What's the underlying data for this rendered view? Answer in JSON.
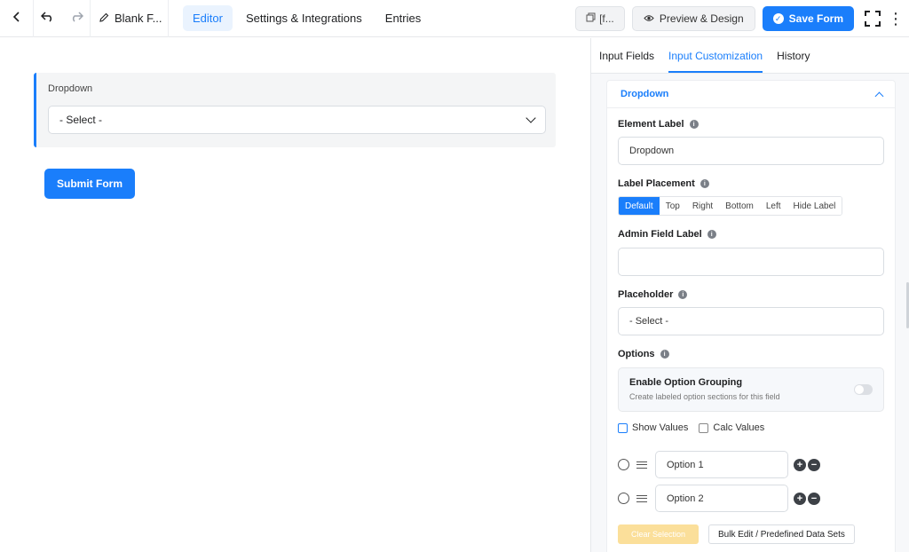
{
  "topbar": {
    "form_title": "Blank F...",
    "nav": [
      {
        "label": "Editor"
      },
      {
        "label": "Settings & Integrations"
      },
      {
        "label": "Entries"
      }
    ],
    "shortcode_label": "[f...",
    "preview_label": "Preview & Design",
    "save_label": "Save Form"
  },
  "canvas": {
    "field_label": "Dropdown",
    "select_value": "- Select -",
    "submit_label": "Submit Form"
  },
  "sidebar": {
    "tabs": [
      {
        "label": "Input Fields"
      },
      {
        "label": "Input Customization"
      },
      {
        "label": "History"
      }
    ],
    "panel_title": "Dropdown",
    "element_label": {
      "label": "Element Label",
      "value": "Dropdown"
    },
    "label_placement": {
      "label": "Label Placement",
      "options": [
        "Default",
        "Top",
        "Right",
        "Bottom",
        "Left",
        "Hide Label"
      ],
      "selected": "Default"
    },
    "admin_field_label": {
      "label": "Admin Field Label",
      "value": ""
    },
    "placeholder": {
      "label": "Placeholder",
      "value": "- Select -"
    },
    "options_label": "Options",
    "option_grouping": {
      "title": "Enable Option Grouping",
      "subtitle": "Create labeled option sections for this field",
      "enabled": false
    },
    "show_values_label": "Show Values",
    "calc_values_label": "Calc Values",
    "options": [
      {
        "label": "Option 1"
      },
      {
        "label": "Option 2"
      }
    ],
    "clear_selection_label": "Clear Selection",
    "bulk_edit_label": "Bulk Edit / Predefined Data Sets"
  },
  "colors": {
    "accent": "#1a7efb",
    "clear_button": "#fbdf9a"
  }
}
